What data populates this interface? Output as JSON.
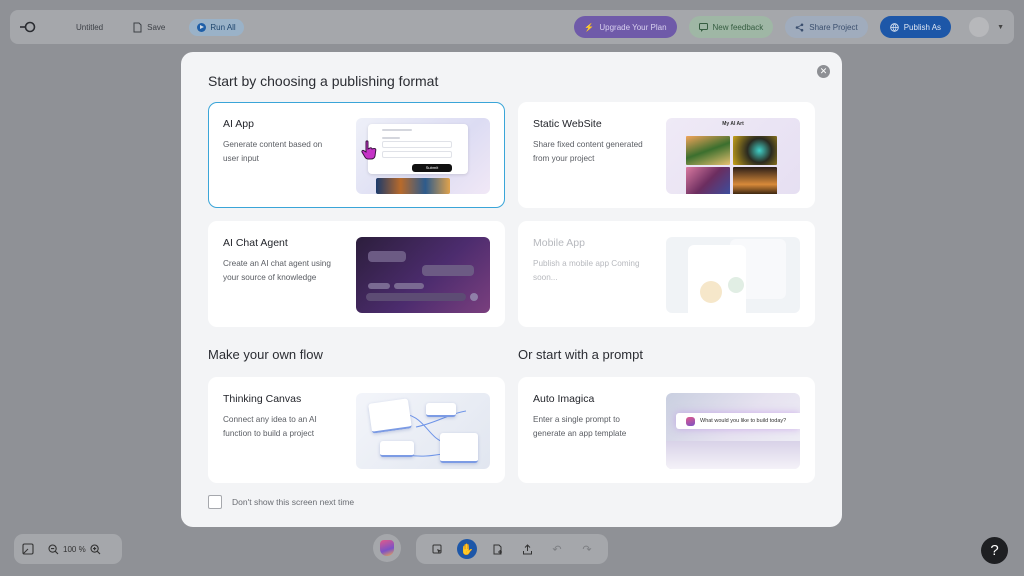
{
  "topbar": {
    "project_name": "Untitled",
    "save_label": "Save",
    "run_label": "Run All",
    "upgrade_label": "Upgrade Your Plan",
    "feedback_label": "New feedback",
    "share_label": "Share Project",
    "publish_label": "Publish As"
  },
  "modal": {
    "title": "Start by choosing a publishing format",
    "cards": [
      {
        "id": "ai-app",
        "title": "AI App",
        "description": "Generate content based on user input",
        "selected": true,
        "disabled": false
      },
      {
        "id": "static-website",
        "title": "Static WebSite",
        "description": "Share fixed content generated from your project",
        "selected": false,
        "disabled": false
      },
      {
        "id": "ai-chat-agent",
        "title": "AI Chat Agent",
        "description": "Create an AI chat agent using your source of knowledge",
        "selected": false,
        "disabled": false
      },
      {
        "id": "mobile-app",
        "title": "Mobile App",
        "description": "Publish a mobile app Coming soon...",
        "selected": false,
        "disabled": true
      },
      {
        "id": "thinking-canvas",
        "title": "Thinking Canvas",
        "description": "Connect any idea to an AI function to build a project",
        "selected": false,
        "disabled": false
      },
      {
        "id": "auto-imagica",
        "title": "Auto Imagica",
        "description": "Enter a single prompt to generate an app template",
        "selected": false,
        "disabled": false
      }
    ],
    "section_own_flow": "Make your own flow",
    "section_prompt": "Or start with a prompt",
    "dont_show_label": "Don't show this screen next time",
    "dont_show_checked": false,
    "thumbs": {
      "app_submit": "Submit",
      "web_header": "My AI Art",
      "prompt_question": "What would you like to build today?"
    }
  },
  "bottom": {
    "zoom_value": "100",
    "zoom_unit": "%",
    "help_label": "?"
  },
  "colors": {
    "accent": "#1d57a8",
    "selected_border": "#3aa5d8",
    "upgrade": "#6f5aa9",
    "feedback": "#9fb7a5"
  }
}
